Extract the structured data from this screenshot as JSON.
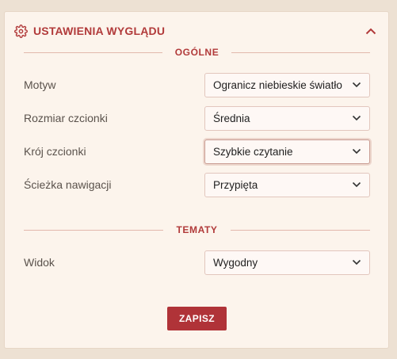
{
  "header": {
    "title": "USTAWIENIA WYGLĄDU"
  },
  "sections": {
    "general": "OGÓLNE",
    "themes": "TEMATY"
  },
  "fields": {
    "motyw": {
      "label": "Motyw",
      "value": "Ogranicz niebieskie światło"
    },
    "rozmiar": {
      "label": "Rozmiar czcionki",
      "value": "Średnia"
    },
    "kroj": {
      "label": "Krój czcionki",
      "value": "Szybkie czytanie"
    },
    "sciezka": {
      "label": "Ścieżka nawigacji",
      "value": "Przypięta"
    },
    "widok": {
      "label": "Widok",
      "value": "Wygodny"
    }
  },
  "actions": {
    "save_label": "ZAPISZ"
  },
  "colors": {
    "accent": "#b13a3a",
    "button": "#b03338",
    "panel": "#fcf4ec",
    "background": "#ede1d3"
  },
  "icons": {
    "header": "gear-icon",
    "collapse": "chevron-up-icon",
    "select": "chevron-down-icon"
  }
}
